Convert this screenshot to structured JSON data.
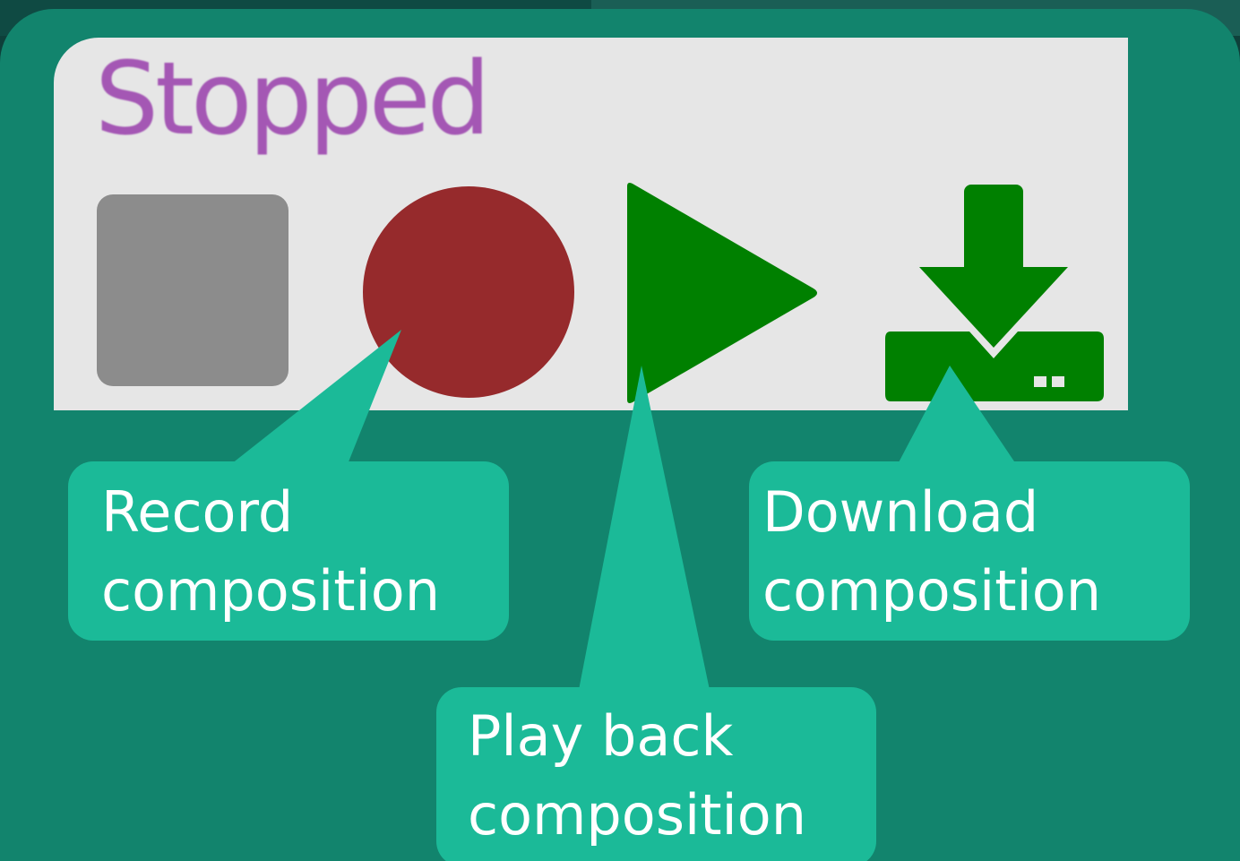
{
  "status": {
    "text": "Stopped"
  },
  "controls": [
    {
      "icon": "stop-icon",
      "color": "#8c8c8c"
    },
    {
      "icon": "record-icon",
      "color": "#962a2c"
    },
    {
      "icon": "play-icon",
      "color": "#008000"
    },
    {
      "icon": "download-icon",
      "color": "#008000"
    }
  ],
  "callouts": {
    "record": "Record\ncomposition",
    "play": "Play back\ncomposition",
    "download": "Download\ncomposition"
  },
  "colors": {
    "panel": "#12846d",
    "callout": "#1bba98",
    "toolbar": "#e6e6e6",
    "status_text": "#a457b4"
  }
}
